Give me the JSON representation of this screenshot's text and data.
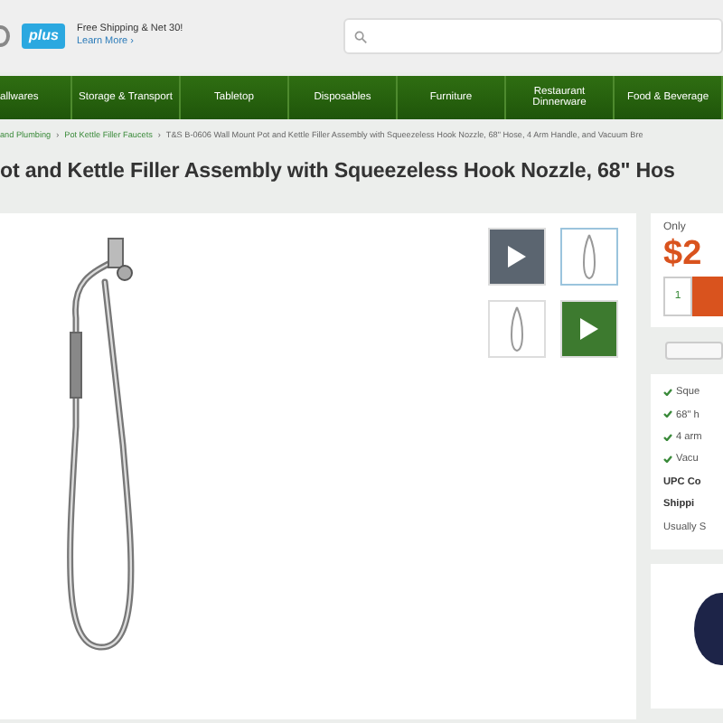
{
  "header": {
    "plus_badge": "plus",
    "promo": "Free Shipping & Net 30!",
    "promo_link": "Learn More ›"
  },
  "nav": [
    "allwares",
    "Storage & Transport",
    "Tabletop",
    "Disposables",
    "Furniture",
    "Restaurant Dinnerware",
    "Food & Beverage"
  ],
  "breadcrumb": [
    "and Plumbing",
    "Pot Kettle Filler Faucets",
    "T&S B-0606 Wall Mount Pot and Kettle Filler Assembly with Squeezeless Hook Nozzle, 68\" Hose, 4 Arm Handle, and Vacuum Bre"
  ],
  "breadcrumb_separator": "›",
  "title": "ot and Kettle Filler Assembly with Squeezeless Hook Nozzle, 68\" Hos",
  "thumbnails": [
    {
      "kind": "video",
      "selected": false
    },
    {
      "kind": "photo",
      "selected": true
    },
    {
      "kind": "photo",
      "selected": false
    },
    {
      "kind": "video",
      "selected": false
    }
  ],
  "price": {
    "label": "Only",
    "amount": "$2",
    "quantity": "1"
  },
  "features": [
    "Sque",
    "68\" h",
    "4 arm",
    "Vacu"
  ],
  "upc_label": "UPC Co",
  "shipping_label": "Shippi",
  "shipping_note": "Usually S"
}
